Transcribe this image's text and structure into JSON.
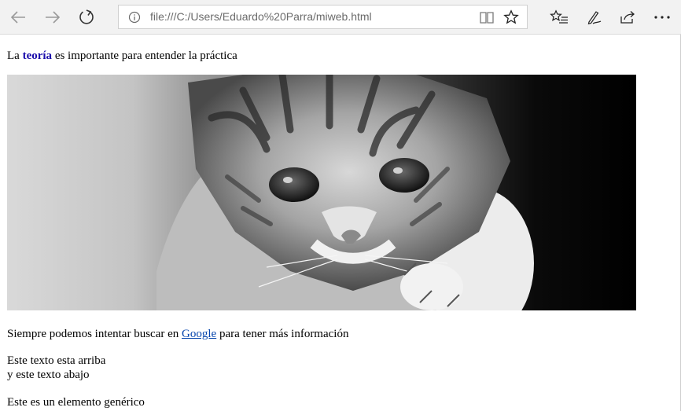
{
  "browser": {
    "address": "file:///C:/Users/Eduardo%20Parra/miweb.html"
  },
  "page": {
    "p1": {
      "before": "La ",
      "strong": "teoría",
      "after": " es importante para entender la práctica"
    },
    "p2": {
      "before": "Siempre podemos intentar buscar en ",
      "link": "Google",
      "after": " para tener más información"
    },
    "p3": {
      "line1": "Este texto esta arriba",
      "line2": "y este texto abajo"
    },
    "p4": "Este es un elemento genérico"
  },
  "colors": {
    "toolbar": "#f2f2f2",
    "link": "#0645ad",
    "strong": "#1a0dab"
  }
}
